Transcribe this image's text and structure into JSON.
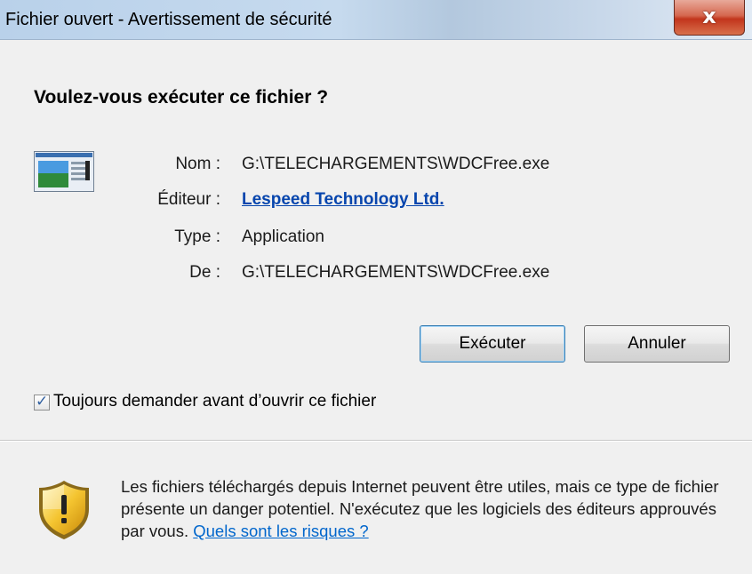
{
  "window": {
    "title": "Fichier ouvert - Avertissement de sécurité",
    "close_icon": "close-icon",
    "close_glyph": "x"
  },
  "dialog": {
    "heading": "Voulez-vous exécuter ce fichier ?",
    "app_icon": "application-file-icon",
    "fields": [
      {
        "label": "Nom :",
        "value": "G:\\TELECHARGEMENTS\\WDCFree.exe"
      },
      {
        "label": "Éditeur :",
        "value": "Lespeed Technology Ltd."
      },
      {
        "label": "Type :",
        "value": "Application"
      },
      {
        "label": "De :",
        "value": "G:\\TELECHARGEMENTS\\WDCFree.exe"
      }
    ],
    "buttons": {
      "run_label": "Exécuter",
      "cancel_label": "Annuler"
    },
    "always_ask": {
      "checked": true,
      "check_glyph": "✓",
      "label": "Toujours demander avant d’ouvrir ce fichier"
    }
  },
  "footer": {
    "shield_icon": "security-shield-icon",
    "warning_text": "Les fichiers téléchargés depuis Internet peuvent être utiles, mais ce type de fichier présente un danger potentiel. N'exécutez que les logiciels des éditeurs approuvés par vous.",
    "risk_link": "Quels sont les risques ?"
  },
  "colors": {
    "link": "#0645ad",
    "titlebar": "#c6daee",
    "close_button": "#c2351c"
  }
}
